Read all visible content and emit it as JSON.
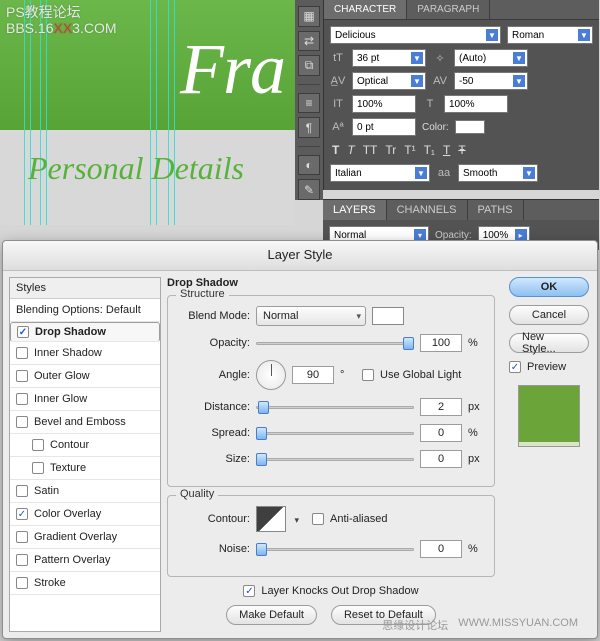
{
  "watermark": {
    "l1": "PS教程论坛",
    "l2a": "BBS.16",
    "l2b": "XX",
    "l2c": "3.COM"
  },
  "canvas": {
    "big_text": "Fra",
    "sub_text": "Personal Details"
  },
  "character": {
    "tab_character": "CHARACTER",
    "tab_paragraph": "PARAGRAPH",
    "font_family": "Delicious",
    "font_style": "Roman",
    "size": "36 pt",
    "leading": "(Auto)",
    "kerning": "Optical",
    "tracking": "-50",
    "vscale": "100%",
    "hscale": "100%",
    "baseline": "0 pt",
    "color_label": "Color:",
    "lang": "Italian",
    "aa_label": "aa",
    "aa_value": "Smooth",
    "styles": {
      "t1": "T",
      "t2": "T",
      "tt": "TT",
      "tr": "Tr",
      "tsup": "T¹",
      "tsub": "T₁",
      "tstrike": "T",
      "tunder": "Ŧ"
    }
  },
  "layers": {
    "tab_layers": "LAYERS",
    "tab_channels": "CHANNELS",
    "tab_paths": "PATHS",
    "blend": "Normal",
    "opacity_label": "Opacity:",
    "opacity_value": "100%"
  },
  "layer_style": {
    "title": "Layer Style",
    "col_header": "Styles",
    "blending_options": "Blending Options: Default",
    "items": {
      "drop_shadow": "Drop Shadow",
      "inner_shadow": "Inner Shadow",
      "outer_glow": "Outer Glow",
      "inner_glow": "Inner Glow",
      "bevel": "Bevel and Emboss",
      "contour": "Contour",
      "texture": "Texture",
      "satin": "Satin",
      "color_overlay": "Color Overlay",
      "gradient_overlay": "Gradient Overlay",
      "pattern_overlay": "Pattern Overlay",
      "stroke": "Stroke"
    },
    "section": "Drop Shadow",
    "structure_title": "Structure",
    "blend_mode_label": "Blend Mode:",
    "blend_mode_value": "Normal",
    "opacity_label": "Opacity:",
    "opacity_value": "100",
    "opacity_unit": "%",
    "angle_label": "Angle:",
    "angle_value": "90",
    "angle_unit": "°",
    "global_light": "Use Global Light",
    "distance_label": "Distance:",
    "distance_value": "2",
    "distance_unit": "px",
    "spread_label": "Spread:",
    "spread_value": "0",
    "spread_unit": "%",
    "size_label": "Size:",
    "size_value": "0",
    "size_unit": "px",
    "quality_title": "Quality",
    "contour_label": "Contour:",
    "anti_aliased": "Anti-aliased",
    "noise_label": "Noise:",
    "noise_value": "0",
    "noise_unit": "%",
    "knocks_out": "Layer Knocks Out Drop Shadow",
    "make_default": "Make Default",
    "reset_default": "Reset to Default",
    "ok": "OK",
    "cancel": "Cancel",
    "new_style": "New Style...",
    "preview": "Preview"
  },
  "footer": {
    "cn": "思缘设计论坛",
    "en": "WWW.MISSYUAN.COM"
  }
}
